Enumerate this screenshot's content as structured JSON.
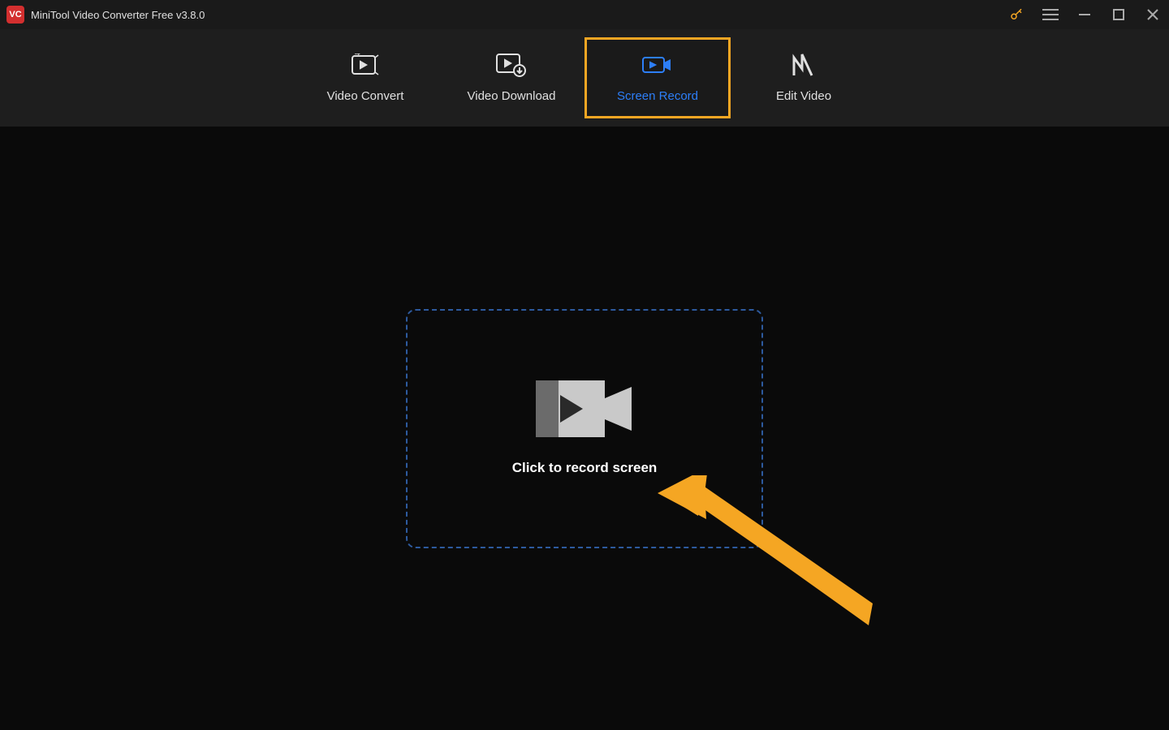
{
  "titlebar": {
    "logo_text": "VC",
    "title": "MiniTool Video Converter Free v3.8.0"
  },
  "nav": {
    "tabs": [
      {
        "label": "Video Convert",
        "active": false
      },
      {
        "label": "Video Download",
        "active": false
      },
      {
        "label": "Screen Record",
        "active": true
      },
      {
        "label": "Edit Video",
        "active": false
      }
    ]
  },
  "main": {
    "record_prompt": "Click to record screen"
  }
}
